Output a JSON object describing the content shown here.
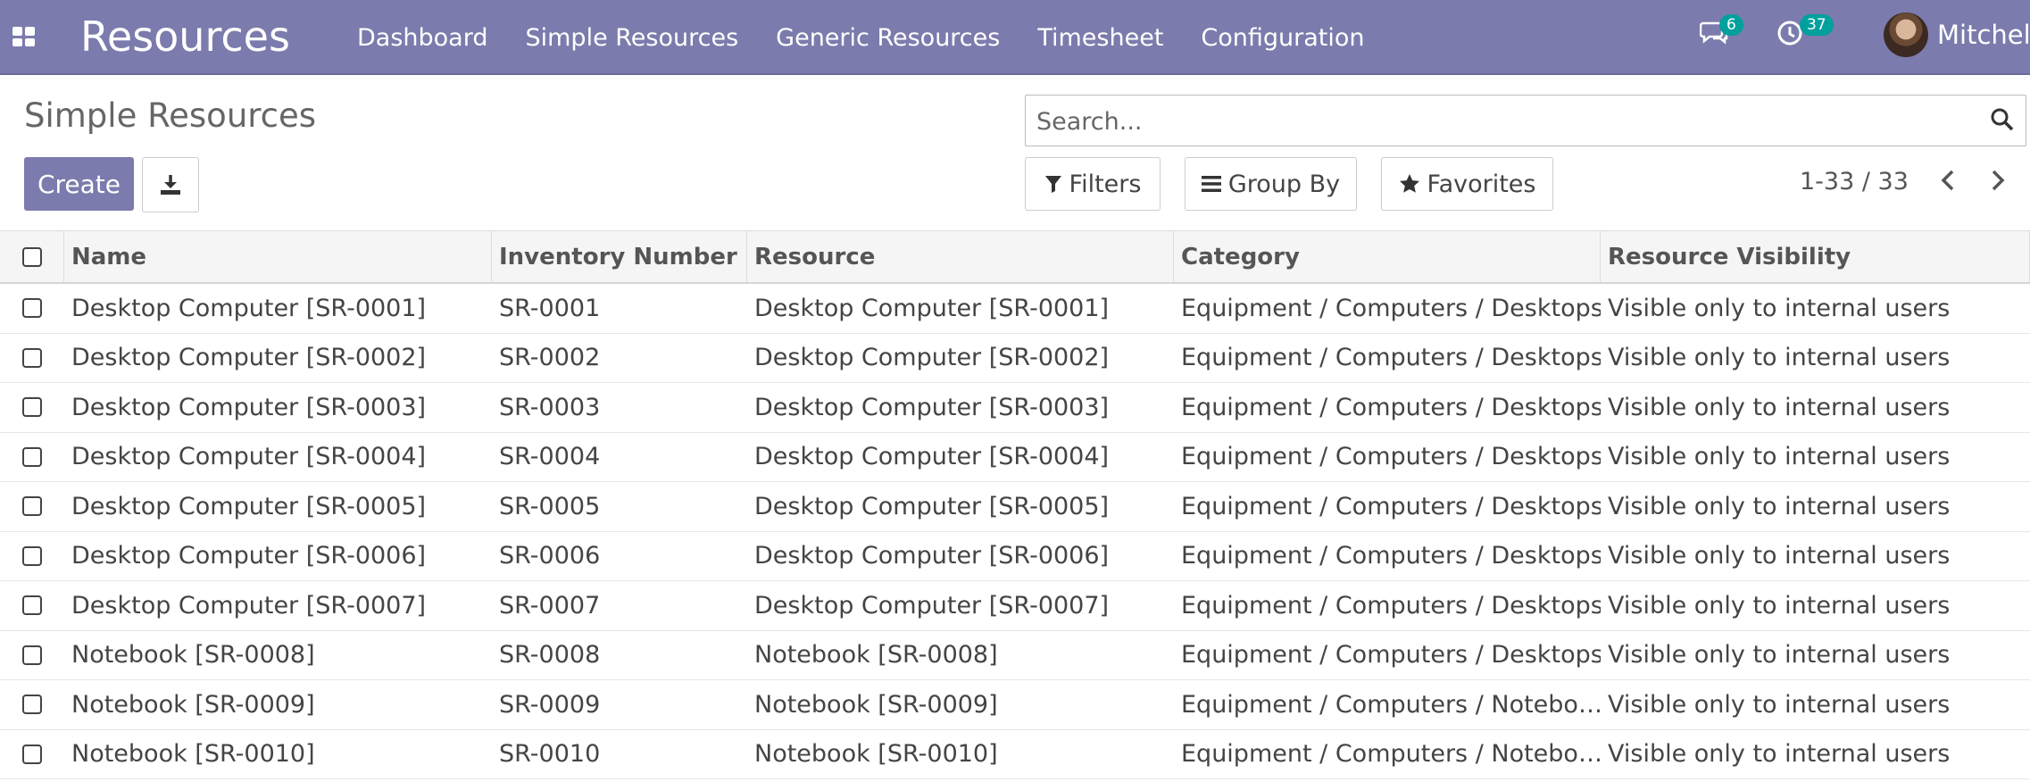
{
  "nav": {
    "app_name": "Resources",
    "menu": [
      "Dashboard",
      "Simple Resources",
      "Generic Resources",
      "Timesheet",
      "Configuration"
    ],
    "messages_count": "6",
    "activities_count": "37",
    "user_name": "Mitchell",
    "accent": "#7c7bad",
    "badge_color": "#00a09d"
  },
  "control_panel": {
    "title": "Simple Resources",
    "create_label": "Create",
    "search_placeholder": "Search...",
    "filters_label": "Filters",
    "group_by_label": "Group By",
    "favorites_label": "Favorites",
    "pager_value": "1-33 / 33"
  },
  "table": {
    "columns": [
      "Name",
      "Inventory Number",
      "Resource",
      "Category",
      "Resource Visibility"
    ],
    "rows": [
      [
        "Desktop Computer [SR-0001]",
        "SR-0001",
        "Desktop Computer [SR-0001]",
        "Equipment / Computers / Desktops",
        "Visible only to internal users"
      ],
      [
        "Desktop Computer [SR-0002]",
        "SR-0002",
        "Desktop Computer [SR-0002]",
        "Equipment / Computers / Desktops",
        "Visible only to internal users"
      ],
      [
        "Desktop Computer [SR-0003]",
        "SR-0003",
        "Desktop Computer [SR-0003]",
        "Equipment / Computers / Desktops",
        "Visible only to internal users"
      ],
      [
        "Desktop Computer [SR-0004]",
        "SR-0004",
        "Desktop Computer [SR-0004]",
        "Equipment / Computers / Desktops",
        "Visible only to internal users"
      ],
      [
        "Desktop Computer [SR-0005]",
        "SR-0005",
        "Desktop Computer [SR-0005]",
        "Equipment / Computers / Desktops",
        "Visible only to internal users"
      ],
      [
        "Desktop Computer [SR-0006]",
        "SR-0006",
        "Desktop Computer [SR-0006]",
        "Equipment / Computers / Desktops",
        "Visible only to internal users"
      ],
      [
        "Desktop Computer [SR-0007]",
        "SR-0007",
        "Desktop Computer [SR-0007]",
        "Equipment / Computers / Desktops",
        "Visible only to internal users"
      ],
      [
        "Notebook [SR-0008]",
        "SR-0008",
        "Notebook [SR-0008]",
        "Equipment / Computers / Desktops",
        "Visible only to internal users"
      ],
      [
        "Notebook [SR-0009]",
        "SR-0009",
        "Notebook [SR-0009]",
        "Equipment / Computers / Notebo…",
        "Visible only to internal users"
      ],
      [
        "Notebook [SR-0010]",
        "SR-0010",
        "Notebook [SR-0010]",
        "Equipment / Computers / Notebo…",
        "Visible only to internal users"
      ]
    ]
  }
}
